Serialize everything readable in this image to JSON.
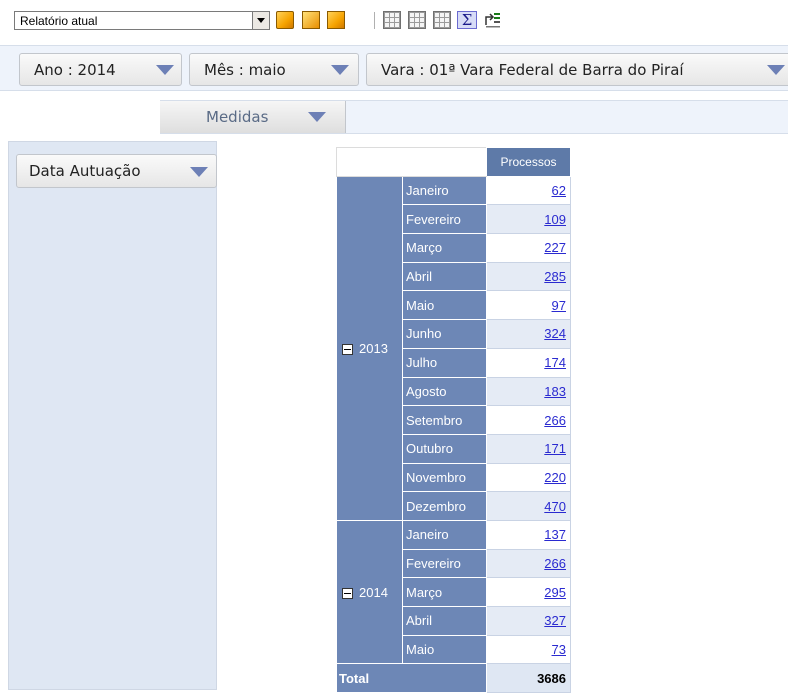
{
  "toolbar": {
    "report_select_value": "Relatório atual",
    "icons": [
      "new-cube-icon",
      "open-cube-icon",
      "save-cube-icon",
      "export-grid-icon",
      "export-grid-2-icon",
      "export-grid-3-icon",
      "sigma-totals-icon",
      "swap-axes-icon"
    ]
  },
  "filters": [
    {
      "label": "Ano : 2014"
    },
    {
      "label": "Mês : maio"
    },
    {
      "label": "Vara : 01ª Vara Federal de Barra do Piraí"
    }
  ],
  "measures": {
    "label": "Medidas"
  },
  "rows_dimension": {
    "label": "Data Autuação"
  },
  "table": {
    "column_header": "Processos",
    "groups": [
      {
        "year": "2013",
        "months": [
          {
            "month": "Janeiro",
            "value": "62"
          },
          {
            "month": "Fevereiro",
            "value": "109"
          },
          {
            "month": "Março",
            "value": "227"
          },
          {
            "month": "Abril",
            "value": "285"
          },
          {
            "month": "Maio",
            "value": "97"
          },
          {
            "month": "Junho",
            "value": "324"
          },
          {
            "month": "Julho",
            "value": "174"
          },
          {
            "month": "Agosto",
            "value": "183"
          },
          {
            "month": "Setembro",
            "value": "266"
          },
          {
            "month": "Outubro",
            "value": "171"
          },
          {
            "month": "Novembro",
            "value": "220"
          },
          {
            "month": "Dezembro",
            "value": "470"
          }
        ]
      },
      {
        "year": "2014",
        "months": [
          {
            "month": "Janeiro",
            "value": "137"
          },
          {
            "month": "Fevereiro",
            "value": "266"
          },
          {
            "month": "Março",
            "value": "295"
          },
          {
            "month": "Abril",
            "value": "327"
          },
          {
            "month": "Maio",
            "value": "73"
          }
        ]
      }
    ],
    "total_label": "Total",
    "total_value": "3686"
  },
  "colors": {
    "header_bg": "#5e7aa8",
    "row_header_bg": "#6d87b6",
    "link": "#2a2ad0",
    "panel_bg": "#dfe7f3",
    "filter_arrow": "#6d80b6"
  }
}
